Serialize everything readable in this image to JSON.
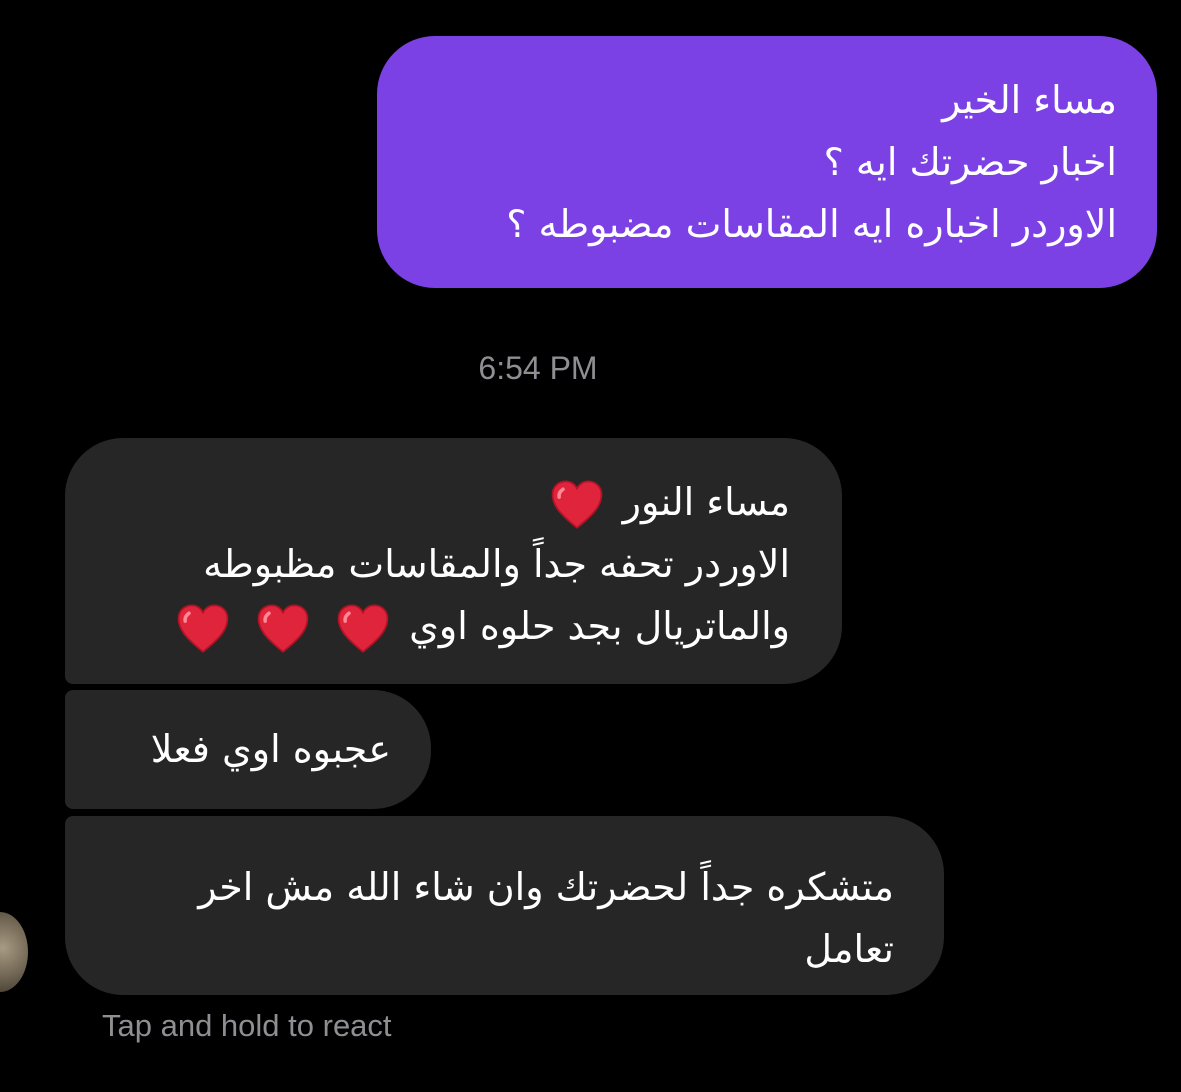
{
  "sent_message": {
    "lines": [
      "مساء الخير",
      "اخبار حضرتك ايه ؟",
      "الاوردر اخباره ايه المقاسات مضبوطه ؟"
    ],
    "bubble_color": "#7b41e4"
  },
  "timestamp": "6:54 PM",
  "received_messages": [
    {
      "lines": [
        "مساء النور",
        "الاوردر تحفه جداً والمقاسات مظبوطه",
        "والماتريال بجد حلوه اوي"
      ],
      "emoji": "red-heart"
    },
    {
      "lines": [
        "عجبوه اوي فعلا"
      ]
    },
    {
      "lines": [
        "متشكره جداً لحضرتك وان شاء الله مش اخر",
        "تعامل"
      ]
    }
  ],
  "received_bubble_color": "#262626",
  "react_hint": "Tap and hold to react"
}
